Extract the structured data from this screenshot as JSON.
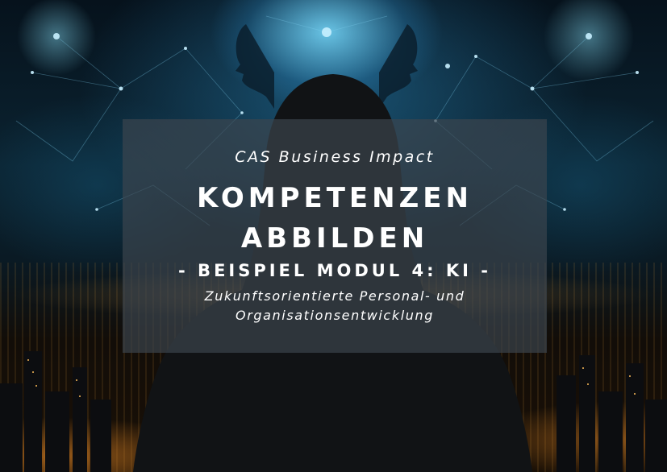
{
  "course": {
    "program": "CAS Business Impact",
    "title_line1": "KOMPETENZEN",
    "title_line2": "ABBILDEN",
    "module": "- BEISPIEL MODUL 4: KI -",
    "description_line1": "Zukunftsorientierte Personal- und",
    "description_line2": "Organisationsentwicklung"
  },
  "colors": {
    "panel": "#3c464e",
    "text": "#ffffff",
    "glow": "#78dcff",
    "city": "#ff9628"
  },
  "background": {
    "icons": [
      "neural-network-icon",
      "head-silhouette-icon",
      "hooded-figure-icon",
      "city-skyline-icon"
    ]
  }
}
